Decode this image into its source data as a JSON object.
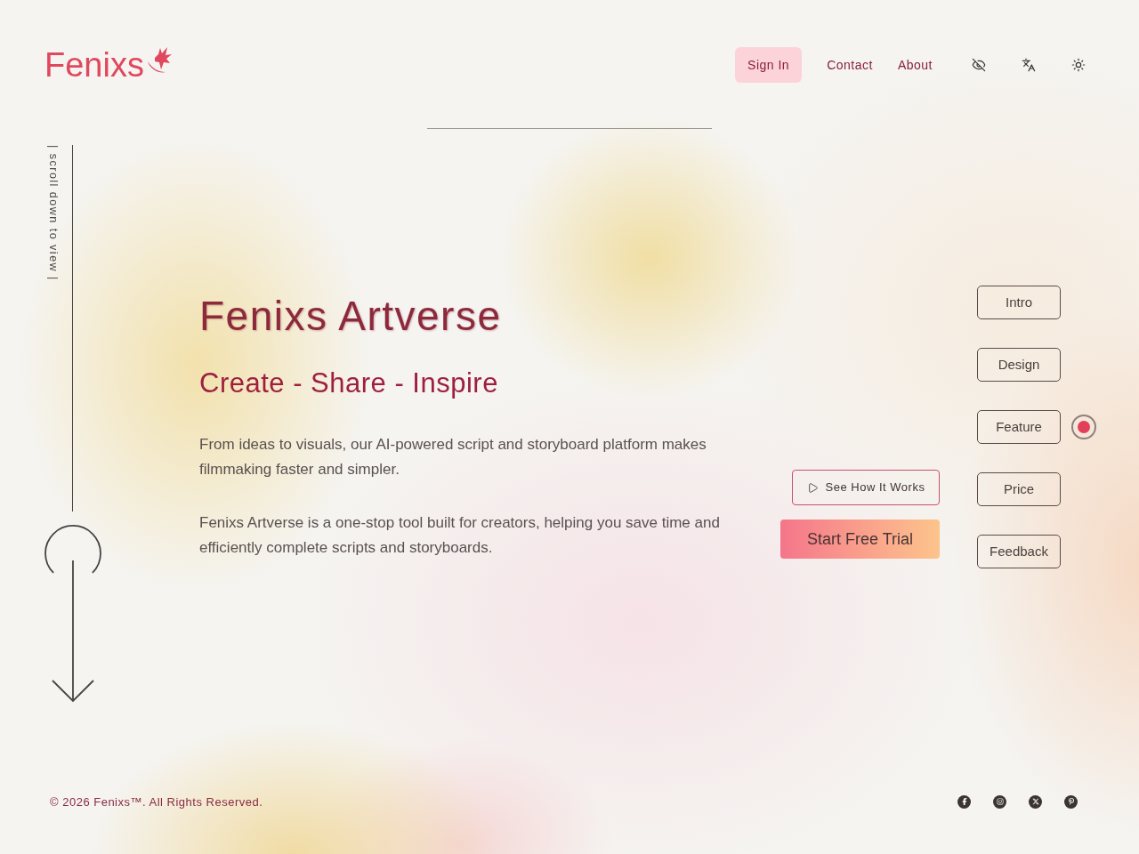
{
  "logo": {
    "text": "Fenixs"
  },
  "nav": {
    "links": [
      {
        "label": "Sign In",
        "kind": "primary"
      },
      {
        "label": "Contact",
        "kind": "link"
      },
      {
        "label": "About",
        "kind": "link"
      }
    ]
  },
  "scroll_hint": "| scroll down to view |",
  "hero": {
    "title": "Fenixs Artverse",
    "subtitle": "Create - Share - Inspire",
    "paragraphs": [
      "From ideas to visuals, our AI-powered script and storyboard platform makes filmmaking faster and simpler.",
      "Fenixs Artverse is a one-stop tool built for creators, helping you save time and efficiently complete scripts and storyboards."
    ]
  },
  "actions": [
    {
      "label": "See How It Works",
      "kind": "outline"
    },
    {
      "label": "Start Free Trial",
      "kind": "gradient"
    }
  ],
  "sections": [
    {
      "label": "Intro",
      "selected": false
    },
    {
      "label": "Design",
      "selected": false
    },
    {
      "label": "Feature",
      "selected": true
    },
    {
      "label": "Price",
      "selected": false
    },
    {
      "label": "Feedback",
      "selected": false
    }
  ],
  "footer": {
    "copyright": "© 2026 Fenixs™. All Rights Reserved."
  }
}
